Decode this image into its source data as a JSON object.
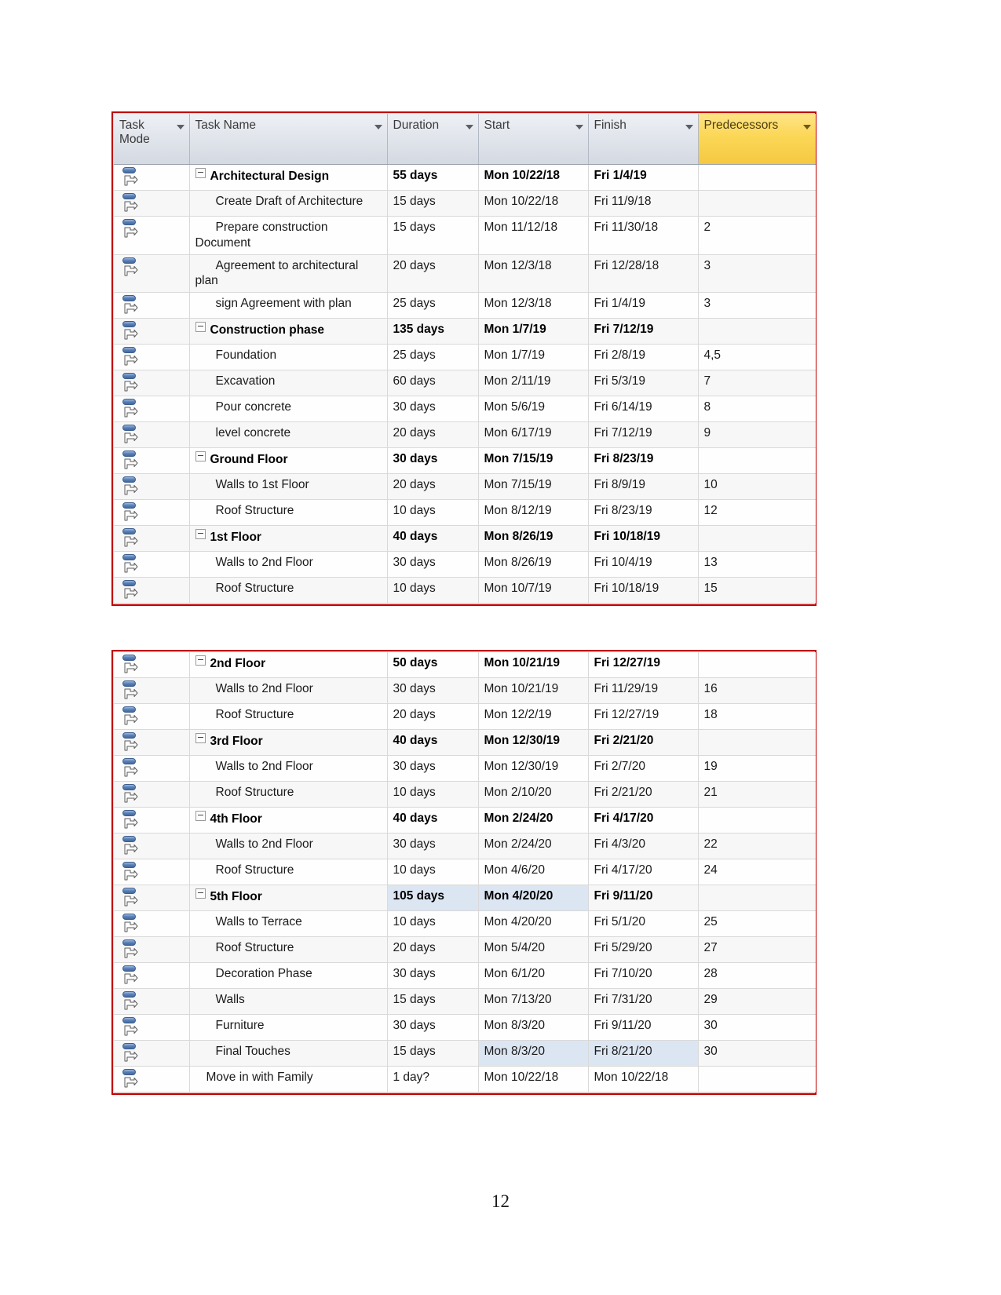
{
  "document": {
    "page_number": "12"
  },
  "table": {
    "columns": [
      {
        "key": "task_mode",
        "label": "Task Mode",
        "has_filter": true,
        "highlighted": false
      },
      {
        "key": "task_name",
        "label": "Task Name",
        "has_filter": true,
        "highlighted": false
      },
      {
        "key": "duration",
        "label": "Duration",
        "has_filter": true,
        "highlighted": false
      },
      {
        "key": "start",
        "label": "Start",
        "has_filter": true,
        "highlighted": false
      },
      {
        "key": "finish",
        "label": "Finish",
        "has_filter": true,
        "highlighted": false
      },
      {
        "key": "predecessors",
        "label": "Predecessors",
        "has_filter": true,
        "highlighted": true
      }
    ],
    "header_colors": {
      "default_background": "#dfe3ea",
      "predecessors_background": "#fbd756",
      "border": "#c00000",
      "selection_highlight": "#dce6f2"
    },
    "task_mode_icon": "auto-scheduled-icon",
    "blocks": [
      {
        "id": "block-1",
        "rows": [
          {
            "task_mode": "auto-scheduled-icon",
            "task_name": "Architectural Design",
            "duration": "55 days",
            "start": "Mon 10/22/18",
            "finish": "Fri 1/4/19",
            "predecessors": "",
            "summary": true,
            "indent": 0,
            "collapsible": true,
            "hl": []
          },
          {
            "task_mode": "auto-scheduled-icon",
            "task_name": "Create Draft of Architecture",
            "duration": "15 days",
            "start": "Mon 10/22/18",
            "finish": "Fri 11/9/18",
            "predecessors": "",
            "summary": false,
            "indent": 1,
            "collapsible": false,
            "hl": []
          },
          {
            "task_mode": "auto-scheduled-icon",
            "task_name": "Prepare construction Document",
            "duration": "15 days",
            "start": "Mon 11/12/18",
            "finish": "Fri 11/30/18",
            "predecessors": "2",
            "summary": false,
            "indent": 1,
            "collapsible": false,
            "hl": []
          },
          {
            "task_mode": "auto-scheduled-icon",
            "task_name": "Agreement to architectural plan",
            "duration": "20 days",
            "start": "Mon 12/3/18",
            "finish": "Fri 12/28/18",
            "predecessors": "3",
            "summary": false,
            "indent": 1,
            "collapsible": false,
            "hl": []
          },
          {
            "task_mode": "auto-scheduled-icon",
            "task_name": "sign Agreement with plan",
            "duration": "25 days",
            "start": "Mon 12/3/18",
            "finish": "Fri 1/4/19",
            "predecessors": "3",
            "summary": false,
            "indent": 1,
            "collapsible": false,
            "hl": []
          },
          {
            "task_mode": "auto-scheduled-icon",
            "task_name": "Construction phase",
            "duration": "135 days",
            "start": "Mon 1/7/19",
            "finish": "Fri 7/12/19",
            "predecessors": "",
            "summary": true,
            "indent": 0,
            "collapsible": true,
            "hl": []
          },
          {
            "task_mode": "auto-scheduled-icon",
            "task_name": "Foundation",
            "duration": "25 days",
            "start": "Mon 1/7/19",
            "finish": "Fri 2/8/19",
            "predecessors": "4,5",
            "summary": false,
            "indent": 1,
            "collapsible": false,
            "hl": []
          },
          {
            "task_mode": "auto-scheduled-icon",
            "task_name": "Excavation",
            "duration": "60 days",
            "start": "Mon 2/11/19",
            "finish": "Fri 5/3/19",
            "predecessors": "7",
            "summary": false,
            "indent": 1,
            "collapsible": false,
            "hl": []
          },
          {
            "task_mode": "auto-scheduled-icon",
            "task_name": "Pour concrete",
            "duration": "30 days",
            "start": "Mon 5/6/19",
            "finish": "Fri 6/14/19",
            "predecessors": "8",
            "summary": false,
            "indent": 1,
            "collapsible": false,
            "hl": []
          },
          {
            "task_mode": "auto-scheduled-icon",
            "task_name": "level concrete",
            "duration": "20 days",
            "start": "Mon 6/17/19",
            "finish": "Fri 7/12/19",
            "predecessors": "9",
            "summary": false,
            "indent": 1,
            "collapsible": false,
            "hl": []
          },
          {
            "task_mode": "auto-scheduled-icon",
            "task_name": "Ground Floor",
            "duration": "30 days",
            "start": "Mon 7/15/19",
            "finish": "Fri 8/23/19",
            "predecessors": "",
            "summary": true,
            "indent": 0,
            "collapsible": true,
            "hl": []
          },
          {
            "task_mode": "auto-scheduled-icon",
            "task_name": "Walls to 1st Floor",
            "duration": "20 days",
            "start": "Mon 7/15/19",
            "finish": "Fri 8/9/19",
            "predecessors": "10",
            "summary": false,
            "indent": 1,
            "collapsible": false,
            "hl": []
          },
          {
            "task_mode": "auto-scheduled-icon",
            "task_name": "Roof Structure",
            "duration": "10 days",
            "start": "Mon 8/12/19",
            "finish": "Fri 8/23/19",
            "predecessors": "12",
            "summary": false,
            "indent": 1,
            "collapsible": false,
            "hl": []
          },
          {
            "task_mode": "auto-scheduled-icon",
            "task_name": "1st Floor",
            "duration": "40 days",
            "start": "Mon 8/26/19",
            "finish": "Fri 10/18/19",
            "predecessors": "",
            "summary": true,
            "indent": 0,
            "collapsible": true,
            "hl": []
          },
          {
            "task_mode": "auto-scheduled-icon",
            "task_name": "Walls to 2nd Floor",
            "duration": "30 days",
            "start": "Mon 8/26/19",
            "finish": "Fri 10/4/19",
            "predecessors": "13",
            "summary": false,
            "indent": 1,
            "collapsible": false,
            "hl": []
          },
          {
            "task_mode": "auto-scheduled-icon",
            "task_name": "Roof Structure",
            "duration": "10 days",
            "start": "Mon 10/7/19",
            "finish": "Fri 10/18/19",
            "predecessors": "15",
            "summary": false,
            "indent": 1,
            "collapsible": false,
            "hl": []
          }
        ]
      },
      {
        "id": "block-2",
        "rows": [
          {
            "task_mode": "auto-scheduled-icon",
            "task_name": "2nd Floor",
            "duration": "50 days",
            "start": "Mon 10/21/19",
            "finish": "Fri 12/27/19",
            "predecessors": "",
            "summary": true,
            "indent": 0,
            "collapsible": true,
            "hl": []
          },
          {
            "task_mode": "auto-scheduled-icon",
            "task_name": "Walls to 2nd Floor",
            "duration": "30 days",
            "start": "Mon 10/21/19",
            "finish": "Fri 11/29/19",
            "predecessors": "16",
            "summary": false,
            "indent": 1,
            "collapsible": false,
            "hl": []
          },
          {
            "task_mode": "auto-scheduled-icon",
            "task_name": "Roof Structure",
            "duration": "20 days",
            "start": "Mon 12/2/19",
            "finish": "Fri 12/27/19",
            "predecessors": "18",
            "summary": false,
            "indent": 1,
            "collapsible": false,
            "hl": []
          },
          {
            "task_mode": "auto-scheduled-icon",
            "task_name": "3rd Floor",
            "duration": "40 days",
            "start": "Mon 12/30/19",
            "finish": "Fri 2/21/20",
            "predecessors": "",
            "summary": true,
            "indent": 0,
            "collapsible": true,
            "hl": []
          },
          {
            "task_mode": "auto-scheduled-icon",
            "task_name": "Walls to 2nd Floor",
            "duration": "30 days",
            "start": "Mon 12/30/19",
            "finish": "Fri 2/7/20",
            "predecessors": "19",
            "summary": false,
            "indent": 1,
            "collapsible": false,
            "hl": []
          },
          {
            "task_mode": "auto-scheduled-icon",
            "task_name": "Roof Structure",
            "duration": "10 days",
            "start": "Mon 2/10/20",
            "finish": "Fri 2/21/20",
            "predecessors": "21",
            "summary": false,
            "indent": 1,
            "collapsible": false,
            "hl": []
          },
          {
            "task_mode": "auto-scheduled-icon",
            "task_name": "4th Floor",
            "duration": "40 days",
            "start": "Mon 2/24/20",
            "finish": "Fri 4/17/20",
            "predecessors": "",
            "summary": true,
            "indent": 0,
            "collapsible": true,
            "hl": []
          },
          {
            "task_mode": "auto-scheduled-icon",
            "task_name": "Walls to 2nd Floor",
            "duration": "30 days",
            "start": "Mon 2/24/20",
            "finish": "Fri 4/3/20",
            "predecessors": "22",
            "summary": false,
            "indent": 1,
            "collapsible": false,
            "hl": []
          },
          {
            "task_mode": "auto-scheduled-icon",
            "task_name": "Roof Structure",
            "duration": "10 days",
            "start": "Mon 4/6/20",
            "finish": "Fri 4/17/20",
            "predecessors": "24",
            "summary": false,
            "indent": 1,
            "collapsible": false,
            "hl": []
          },
          {
            "task_mode": "auto-scheduled-icon",
            "task_name": "5th Floor",
            "duration": "105 days",
            "start": "Mon 4/20/20",
            "finish": "Fri 9/11/20",
            "predecessors": "",
            "summary": true,
            "indent": 0,
            "collapsible": true,
            "hl": [
              "duration",
              "start"
            ]
          },
          {
            "task_mode": "auto-scheduled-icon",
            "task_name": "Walls to Terrace",
            "duration": "10 days",
            "start": "Mon 4/20/20",
            "finish": "Fri 5/1/20",
            "predecessors": "25",
            "summary": false,
            "indent": 1,
            "collapsible": false,
            "hl": []
          },
          {
            "task_mode": "auto-scheduled-icon",
            "task_name": "Roof Structure",
            "duration": "20 days",
            "start": "Mon 5/4/20",
            "finish": "Fri 5/29/20",
            "predecessors": "27",
            "summary": false,
            "indent": 1,
            "collapsible": false,
            "hl": []
          },
          {
            "task_mode": "auto-scheduled-icon",
            "task_name": "Decoration Phase",
            "duration": "30 days",
            "start": "Mon 6/1/20",
            "finish": "Fri 7/10/20",
            "predecessors": "28",
            "summary": false,
            "indent": 1,
            "collapsible": false,
            "hl": []
          },
          {
            "task_mode": "auto-scheduled-icon",
            "task_name": "Walls",
            "duration": "15 days",
            "start": "Mon 7/13/20",
            "finish": "Fri 7/31/20",
            "predecessors": "29",
            "summary": false,
            "indent": 1,
            "collapsible": false,
            "hl": []
          },
          {
            "task_mode": "auto-scheduled-icon",
            "task_name": "Furniture",
            "duration": "30 days",
            "start": "Mon 8/3/20",
            "finish": "Fri 9/11/20",
            "predecessors": "30",
            "summary": false,
            "indent": 1,
            "collapsible": false,
            "hl": []
          },
          {
            "task_mode": "auto-scheduled-icon",
            "task_name": "Final Touches",
            "duration": "15 days",
            "start": "Mon 8/3/20",
            "finish": "Fri 8/21/20",
            "predecessors": "30",
            "summary": false,
            "indent": 1,
            "collapsible": false,
            "hl": [
              "start",
              "finish"
            ]
          },
          {
            "task_mode": "auto-scheduled-icon",
            "task_name": "Move in with Family",
            "duration": "1 day?",
            "start": "Mon 10/22/18",
            "finish": "Mon 10/22/18",
            "predecessors": "",
            "summary": false,
            "indent": 2,
            "collapsible": false,
            "hl": []
          }
        ]
      }
    ]
  }
}
